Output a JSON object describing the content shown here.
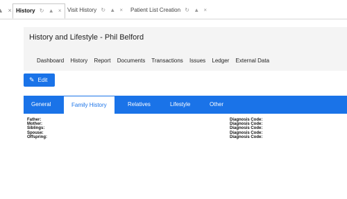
{
  "window_tabs": {
    "lead_glyphs": "⌂ ×",
    "tabs": [
      {
        "label": "History",
        "active": true
      },
      {
        "label": "Visit History",
        "active": false
      },
      {
        "label": "Patient List Creation",
        "active": false
      }
    ]
  },
  "header": {
    "title": "History and Lifestyle - Phil Belford",
    "nav": [
      "Dashboard",
      "History",
      "Report",
      "Documents",
      "Transactions",
      "Issues",
      "Ledger",
      "External Data"
    ]
  },
  "edit_button": {
    "label": "Edit"
  },
  "subtabs": [
    "General",
    "Family History",
    "Relatives",
    "Lifestyle",
    "Other"
  ],
  "active_subtab": "Family History",
  "family_history": {
    "relations": [
      "Father:",
      "Mother:",
      "Siblings:",
      "Spouse:",
      "Offspring:"
    ],
    "diagnosis_label": "Diagnosis Code:"
  },
  "colors": {
    "accent": "#1a73e8",
    "header_bg": "#f4f4f4"
  },
  "icons": {
    "tab_refresh": "refresh-icon",
    "tab_lock": "lock-icon",
    "tab_close": "close-icon",
    "edit": "pencil-icon"
  }
}
